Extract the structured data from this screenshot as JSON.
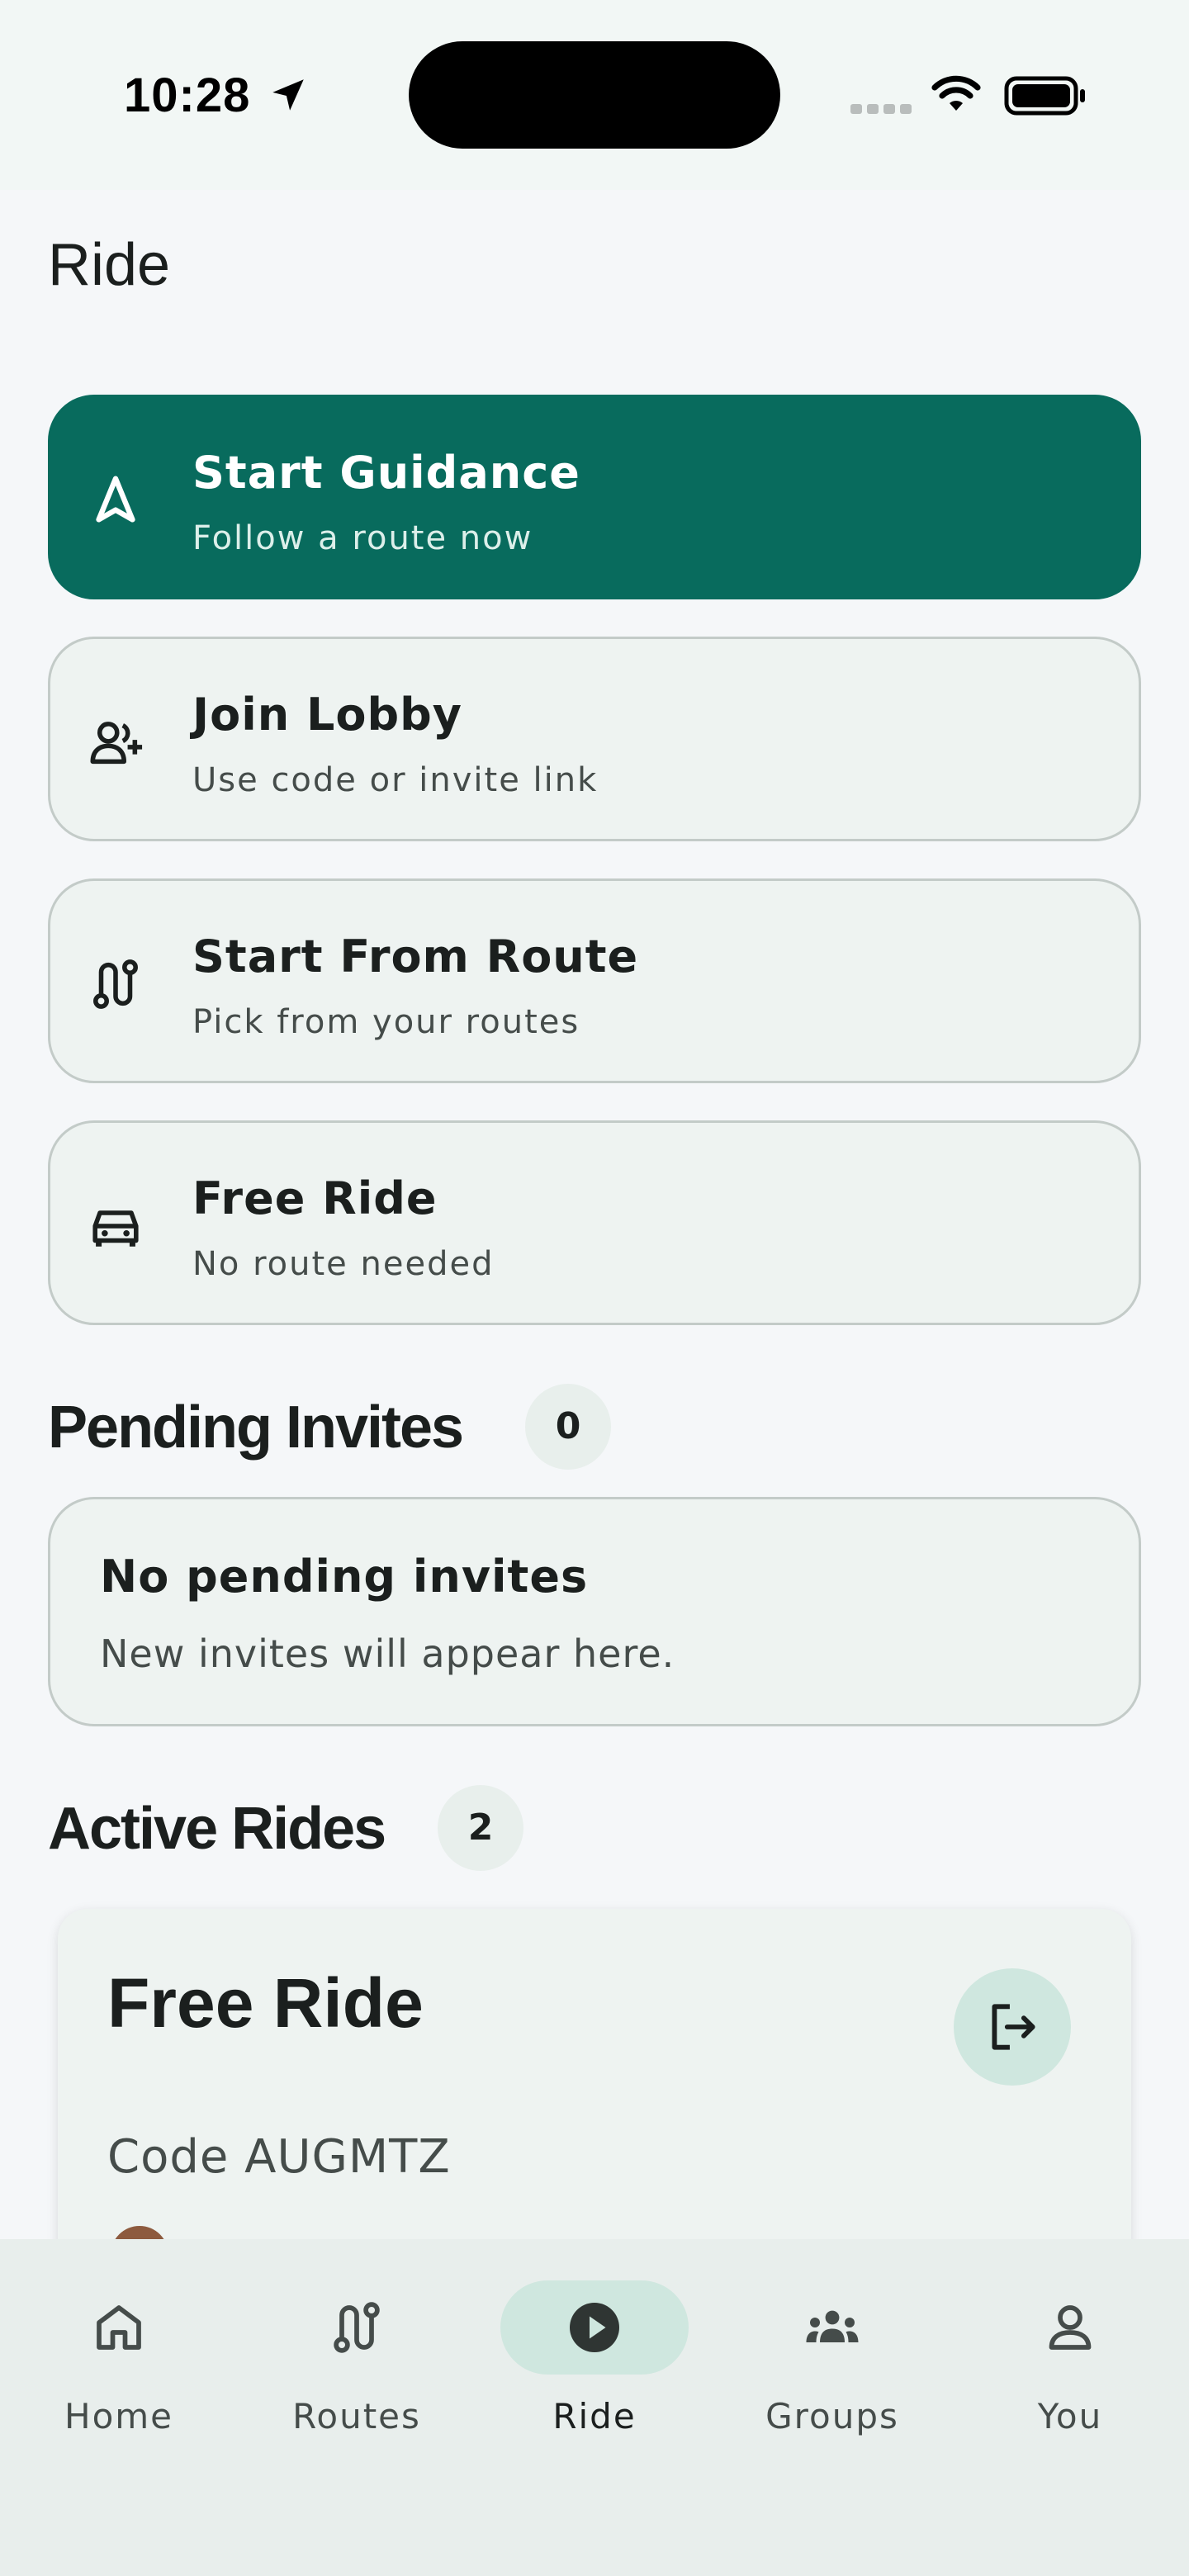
{
  "status_bar": {
    "time": "10:28",
    "icons": [
      "location-arrow-icon",
      "signal-icon",
      "wifi-icon",
      "battery-icon"
    ]
  },
  "header": {
    "title": "Ride"
  },
  "actions": [
    {
      "title": "Start Guidance",
      "subtitle": "Follow a route now",
      "icon": "navigation-arrow-icon",
      "primary": true
    },
    {
      "title": "Join Lobby",
      "subtitle": "Use code or invite link",
      "icon": "add-user-icon"
    },
    {
      "title": "Start From Route",
      "subtitle": "Pick from your routes",
      "icon": "route-icon"
    },
    {
      "title": "Free Ride",
      "subtitle": "No route needed",
      "icon": "car-icon"
    }
  ],
  "pending_invites": {
    "title": "Pending Invites",
    "count": "0",
    "empty_title": "No pending invites",
    "empty_subtitle": "New invites will appear here."
  },
  "active_rides": {
    "title": "Active Rides",
    "count": "2",
    "rides": [
      {
        "title": "Free Ride",
        "code": "Code AUGMTZ",
        "action_icon": "leave-icon"
      }
    ]
  },
  "nav": {
    "active": "Ride",
    "items": [
      {
        "label": "Home",
        "icon": "home-icon"
      },
      {
        "label": "Routes",
        "icon": "route-icon"
      },
      {
        "label": "Ride",
        "icon": "play-icon"
      },
      {
        "label": "Groups",
        "icon": "groups-icon"
      },
      {
        "label": "You",
        "icon": "person-icon"
      }
    ]
  },
  "colors": {
    "primary": "#086b5d",
    "accent_soft": "#cfe7df",
    "background": "#f5f7f9",
    "card": "#eef3f1"
  }
}
